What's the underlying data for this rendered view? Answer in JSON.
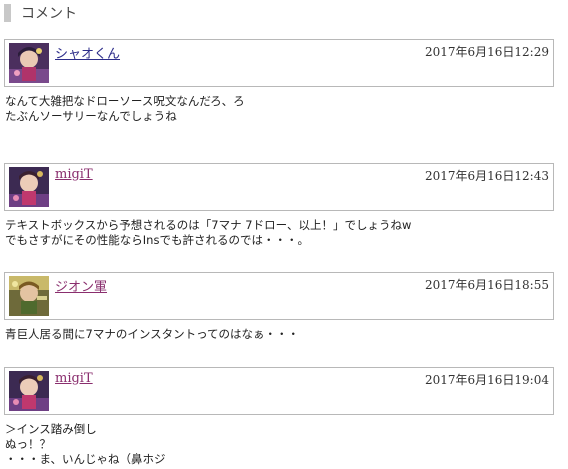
{
  "section": {
    "title": "コメント"
  },
  "comments": [
    {
      "author": "シャオくん",
      "timestamp": "2017年6月16日12:29",
      "avatar": "avatar-character-icon",
      "body": "なんて大雑把なドローソース呪文なんだろ、ろ\nたぶんソーサリーなんでしょうね"
    },
    {
      "author": "migiT",
      "timestamp": "2017年6月16日12:43",
      "avatar": "avatar-character-icon",
      "body": "テキストボックスから予想されるのは「7マナ 7ドロー、以上！」でしょうねw\nでもさすがにその性能ならInsでも許されるのでは・・・。"
    },
    {
      "author": "ジオン軍",
      "timestamp": "2017年6月16日18:55",
      "avatar": "avatar-character-icon",
      "body": "青巨人居る間に7マナのインスタントってのはなぁ・・・"
    },
    {
      "author": "migiT",
      "timestamp": "2017年6月16日19:04",
      "avatar": "avatar-character-icon",
      "body": "＞インス踏み倒し\nぬっ！？\n・・・ま、いんじゃね（鼻ホジ"
    }
  ]
}
